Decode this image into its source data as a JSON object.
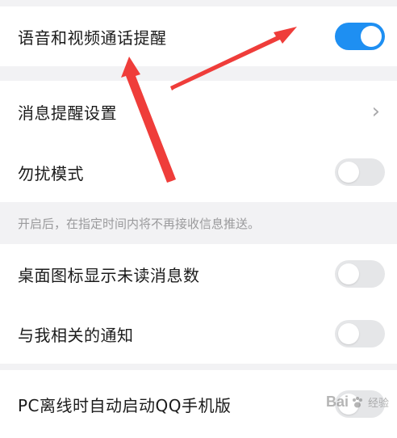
{
  "settings": {
    "voice_video_label": "语音和视频通话提醒",
    "voice_video_on": true,
    "message_settings_label": "消息提醒设置",
    "dnd_label": "勿扰模式",
    "dnd_on": false,
    "dnd_hint": "开启后，在指定时间内将不再接收信息推送。",
    "badge_label": "桌面图标显示未读消息数",
    "badge_on": false,
    "related_label": "与我相关的通知",
    "related_on": false,
    "pc_offline_label": "PC离线时自动启动QQ手机版",
    "pc_offline_on": false
  },
  "colors": {
    "toggle_on": "#1e8ff2",
    "toggle_off": "#e5e6e8",
    "annotation_arrow": "#ef3d3a"
  },
  "watermark": {
    "brand": "Bai",
    "brand_tail": "经验",
    "icon": "paw-icon"
  }
}
